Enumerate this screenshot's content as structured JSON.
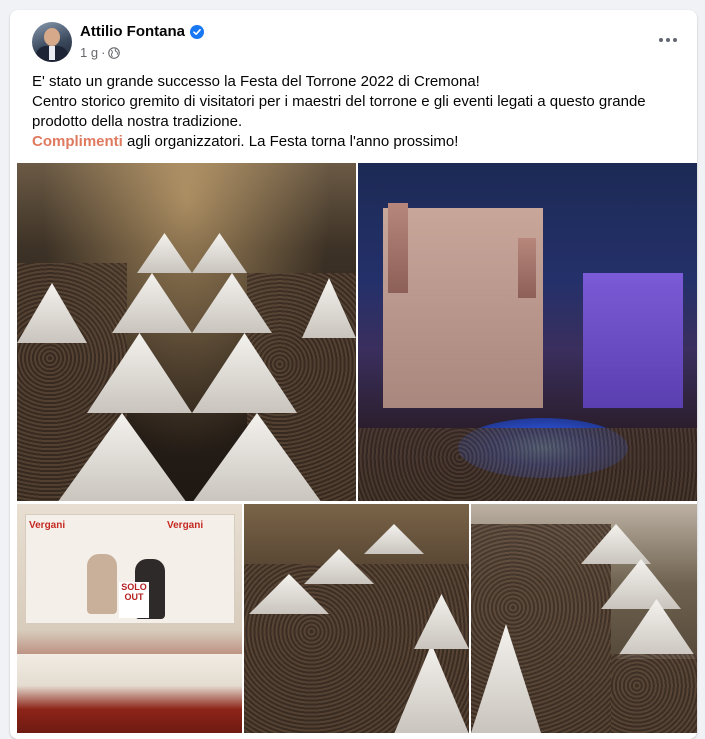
{
  "post": {
    "author": "Attilio Fontana",
    "time": "1 g",
    "lines": [
      "E' stato un grande successo la Festa del Torrone 2022 di Cremona!",
      "Centro storico gremito di visitatori per i maestri del torrone e gli eventi legati a questo grande",
      "prodotto della nostra tradizione."
    ],
    "highlight_word": "Complimenti",
    "closing": " agli organizzatori. La Festa torna l'anno prossimo!"
  },
  "photos": {
    "sign_top": "SOLO",
    "sign_bottom": "OUT",
    "brand": "Vergani"
  },
  "colors": {
    "verified": "#1877f2",
    "highlight": "#e07a5f"
  },
  "icons": {
    "verified": "verified-badge-icon",
    "audience": "globe-icon",
    "more": "more-options-icon"
  }
}
